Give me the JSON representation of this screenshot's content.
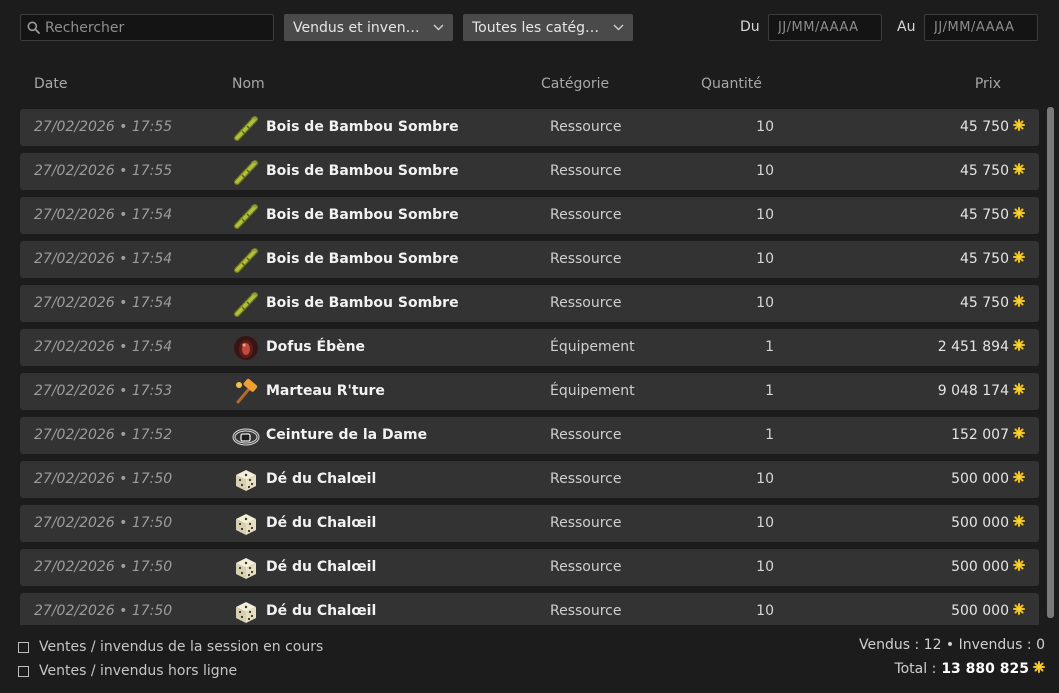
{
  "filters": {
    "search_placeholder": "Rechercher",
    "status_dropdown": "Vendus et invendus",
    "category_dropdown": "Toutes les catégories",
    "date_from_label": "Du",
    "date_to_label": "Au",
    "date_placeholder": "JJ/MM/AAAA"
  },
  "columns": {
    "date": "Date",
    "name": "Nom",
    "category": "Catégorie",
    "quantity": "Quantité",
    "price": "Prix"
  },
  "rows": [
    {
      "date": "27/02/2026 • 17:55",
      "icon": "bamboo-wood-icon",
      "name": "Bois de Bambou Sombre",
      "category": "Ressource",
      "quantity": "10",
      "price": "45 750"
    },
    {
      "date": "27/02/2026 • 17:55",
      "icon": "bamboo-wood-icon",
      "name": "Bois de Bambou Sombre",
      "category": "Ressource",
      "quantity": "10",
      "price": "45 750"
    },
    {
      "date": "27/02/2026 • 17:54",
      "icon": "bamboo-wood-icon",
      "name": "Bois de Bambou Sombre",
      "category": "Ressource",
      "quantity": "10",
      "price": "45 750"
    },
    {
      "date": "27/02/2026 • 17:54",
      "icon": "bamboo-wood-icon",
      "name": "Bois de Bambou Sombre",
      "category": "Ressource",
      "quantity": "10",
      "price": "45 750"
    },
    {
      "date": "27/02/2026 • 17:54",
      "icon": "bamboo-wood-icon",
      "name": "Bois de Bambou Sombre",
      "category": "Ressource",
      "quantity": "10",
      "price": "45 750"
    },
    {
      "date": "27/02/2026 • 17:54",
      "icon": "dofus-egg-icon",
      "name": "Dofus Ébène",
      "category": "Équipement",
      "quantity": "1",
      "price": "2 451 894"
    },
    {
      "date": "27/02/2026 • 17:53",
      "icon": "hammer-icon",
      "name": "Marteau R'ture",
      "category": "Équipement",
      "quantity": "1",
      "price": "9 048 174"
    },
    {
      "date": "27/02/2026 • 17:52",
      "icon": "belt-icon",
      "name": "Ceinture de la Dame",
      "category": "Ressource",
      "quantity": "1",
      "price": "152 007"
    },
    {
      "date": "27/02/2026 • 17:50",
      "icon": "dice-icon",
      "name": "Dé du Chalœil",
      "category": "Ressource",
      "quantity": "10",
      "price": "500 000"
    },
    {
      "date": "27/02/2026 • 17:50",
      "icon": "dice-icon",
      "name": "Dé du Chalœil",
      "category": "Ressource",
      "quantity": "10",
      "price": "500 000"
    },
    {
      "date": "27/02/2026 • 17:50",
      "icon": "dice-icon",
      "name": "Dé du Chalœil",
      "category": "Ressource",
      "quantity": "10",
      "price": "500 000"
    },
    {
      "date": "27/02/2026 • 17:50",
      "icon": "dice-icon",
      "name": "Dé du Chalœil",
      "category": "Ressource",
      "quantity": "10",
      "price": "500 000"
    }
  ],
  "footer": {
    "session_checkbox_label": "Ventes / invendus de la session en cours",
    "offline_checkbox_label": "Ventes / invendus hors ligne",
    "summary": "Vendus : 12 • Invendus : 0",
    "total_label": "Total :",
    "total_value": "13 880 825"
  },
  "colors": {
    "kama_accent": "#f2c21b",
    "row_background": "#333333",
    "page_background": "#1c1c1c"
  }
}
